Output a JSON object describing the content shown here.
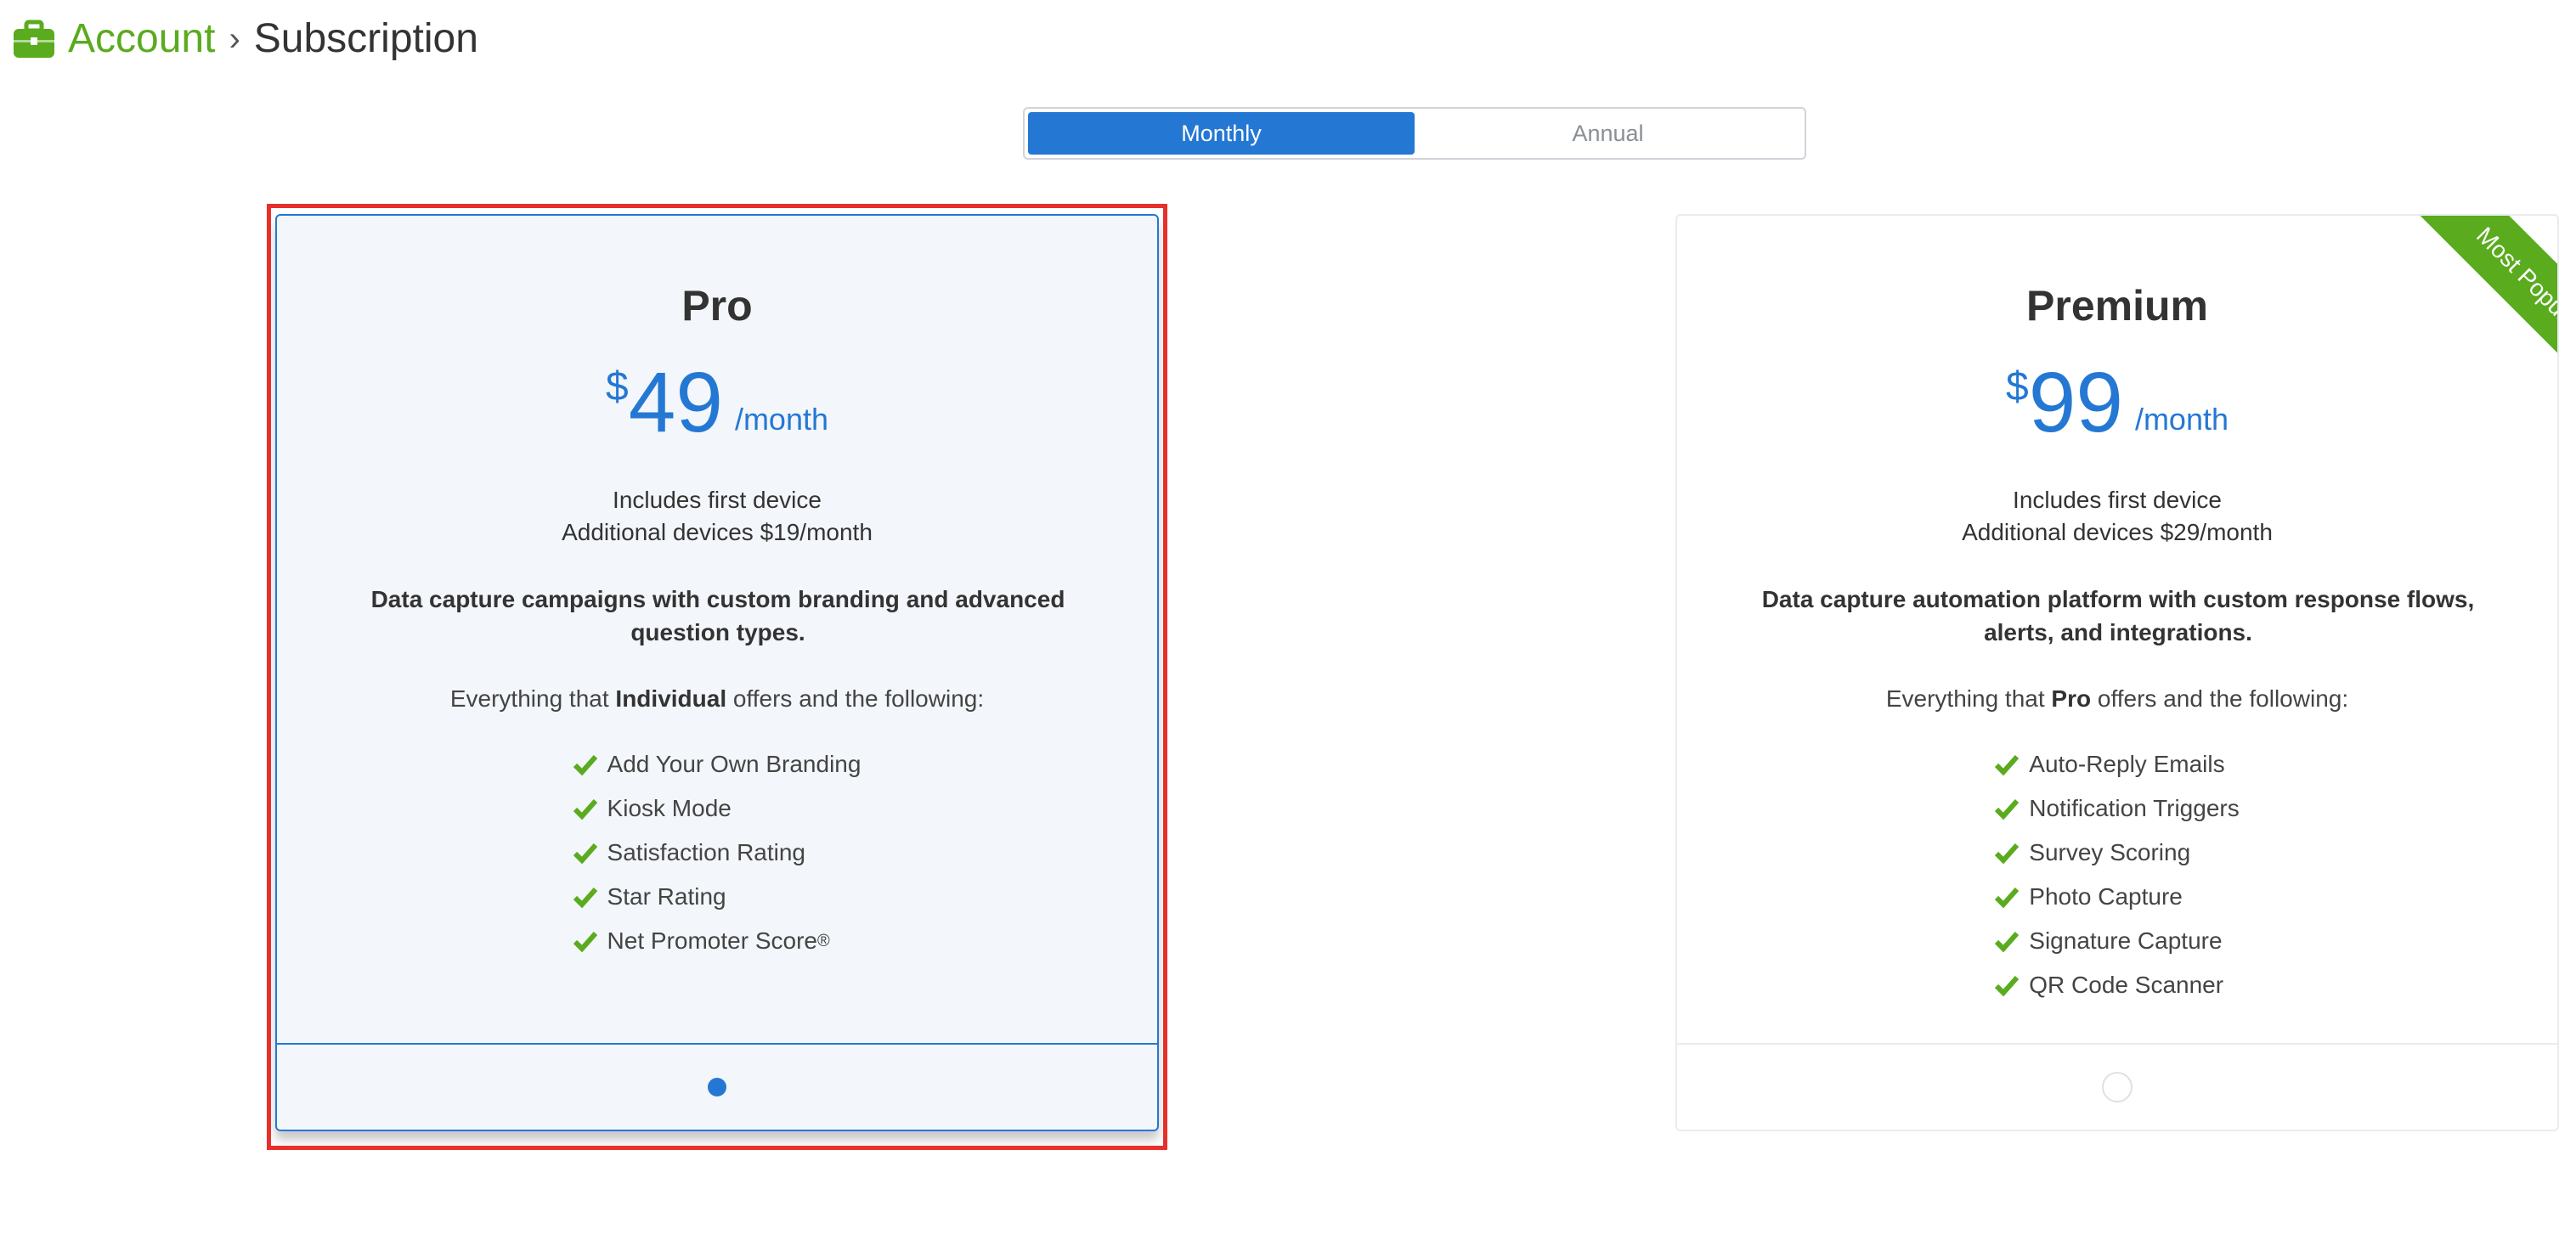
{
  "breadcrumb": {
    "icon": "briefcase-icon",
    "parent": "Account",
    "separator": "›",
    "current": "Subscription"
  },
  "billing_toggle": {
    "options": [
      "Monthly",
      "Annual"
    ],
    "selected": "Monthly"
  },
  "plans": [
    {
      "name": "Pro",
      "currency": "$",
      "price": "49",
      "period": "/month",
      "devices_line1": "Includes first device",
      "devices_line2": "Additional devices $19/month",
      "description": "Data capture campaigns with custom branding and advanced question types.",
      "everything_prefix": "Everything that ",
      "everything_plan": "Individual",
      "everything_suffix": " offers and the following:",
      "features": [
        "Add Your Own Branding",
        "Kiosk Mode",
        "Satisfaction Rating",
        "Star Rating",
        "Net Promoter Score"
      ],
      "last_feature_mark": "®",
      "selected": true
    },
    {
      "name": "Premium",
      "currency": "$",
      "price": "99",
      "period": "/month",
      "devices_line1": "Includes first device",
      "devices_line2": "Additional devices $29/month",
      "description": "Data capture automation platform with custom response flows, alerts, and integrations.",
      "everything_prefix": "Everything that ",
      "everything_plan": "Pro",
      "everything_suffix": " offers and the following:",
      "features": [
        "Auto-Reply Emails",
        "Notification Triggers",
        "Survey Scoring",
        "Photo Capture",
        "Signature Capture",
        "QR Code Scanner"
      ],
      "ribbon": "Most Popular",
      "selected": false
    }
  ],
  "colors": {
    "brand_green": "#5aab1e",
    "accent_blue": "#2478d3",
    "highlight_red": "#e8302a"
  }
}
